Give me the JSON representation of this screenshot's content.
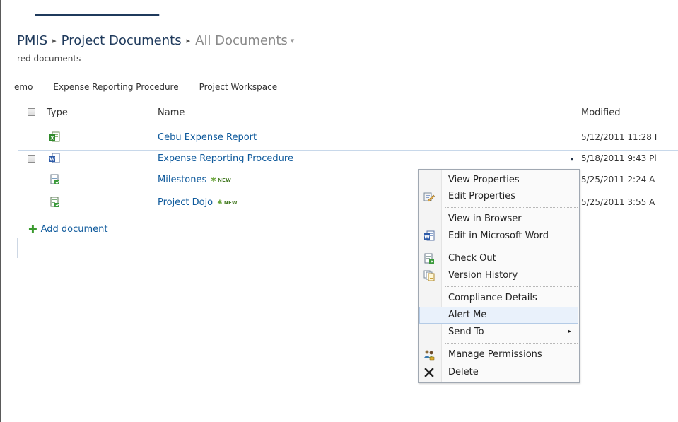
{
  "breadcrumb": {
    "site": "PMIS",
    "library": "Project Documents",
    "view": "All Documents",
    "separator": "▸",
    "caret": "▾"
  },
  "subtitle": "red documents",
  "quicklinks": [
    "emo",
    "Expense Reporting Procedure",
    "Project Workspace"
  ],
  "columns": {
    "type": "Type",
    "name": "Name",
    "modified": "Modified"
  },
  "rows": [
    {
      "name": "Cebu Expense Report",
      "modified": "5/12/2011 11:28 I",
      "icon": "excel-doc-icon",
      "new": false
    },
    {
      "name": "Expense Reporting Procedure",
      "modified": "5/18/2011 9:43 Pl",
      "icon": "word-doc-icon",
      "new": false,
      "selected": true
    },
    {
      "name": "Milestones",
      "modified": "5/25/2011 2:24 A",
      "icon": "project-doc-icon",
      "new": true
    },
    {
      "name": "Project Dojo",
      "modified": "5/25/2011 3:55 A",
      "icon": "project-doc-icon",
      "new": true
    }
  ],
  "new_badge": "NEW",
  "add_document": "Add document",
  "edit_control_block_caret": "▾",
  "context_menu": {
    "items": [
      {
        "label": "View Properties",
        "icon": ""
      },
      {
        "label": "Edit Properties",
        "icon": "edit-properties-icon"
      },
      {
        "label": "View in Browser",
        "icon": ""
      },
      {
        "label": "Edit in Microsoft Word",
        "icon": "word-doc-icon"
      },
      {
        "label": "Check Out",
        "icon": "check-out-icon"
      },
      {
        "label": "Version History",
        "icon": "version-history-icon"
      },
      {
        "label": "Compliance Details",
        "icon": ""
      },
      {
        "label": "Alert Me",
        "icon": "",
        "highlighted": true
      },
      {
        "label": "Send To",
        "icon": "",
        "submenu": true
      },
      {
        "label": "Manage Permissions",
        "icon": "manage-permissions-icon"
      },
      {
        "label": "Delete",
        "icon": "delete-icon"
      }
    ],
    "submenu_arrow": "▸"
  },
  "colors": {
    "link": "#0f5a9c",
    "title": "#1f3a5c",
    "menu_highlight": "#e9f1fb",
    "new_badge": "#4a7d2a"
  }
}
